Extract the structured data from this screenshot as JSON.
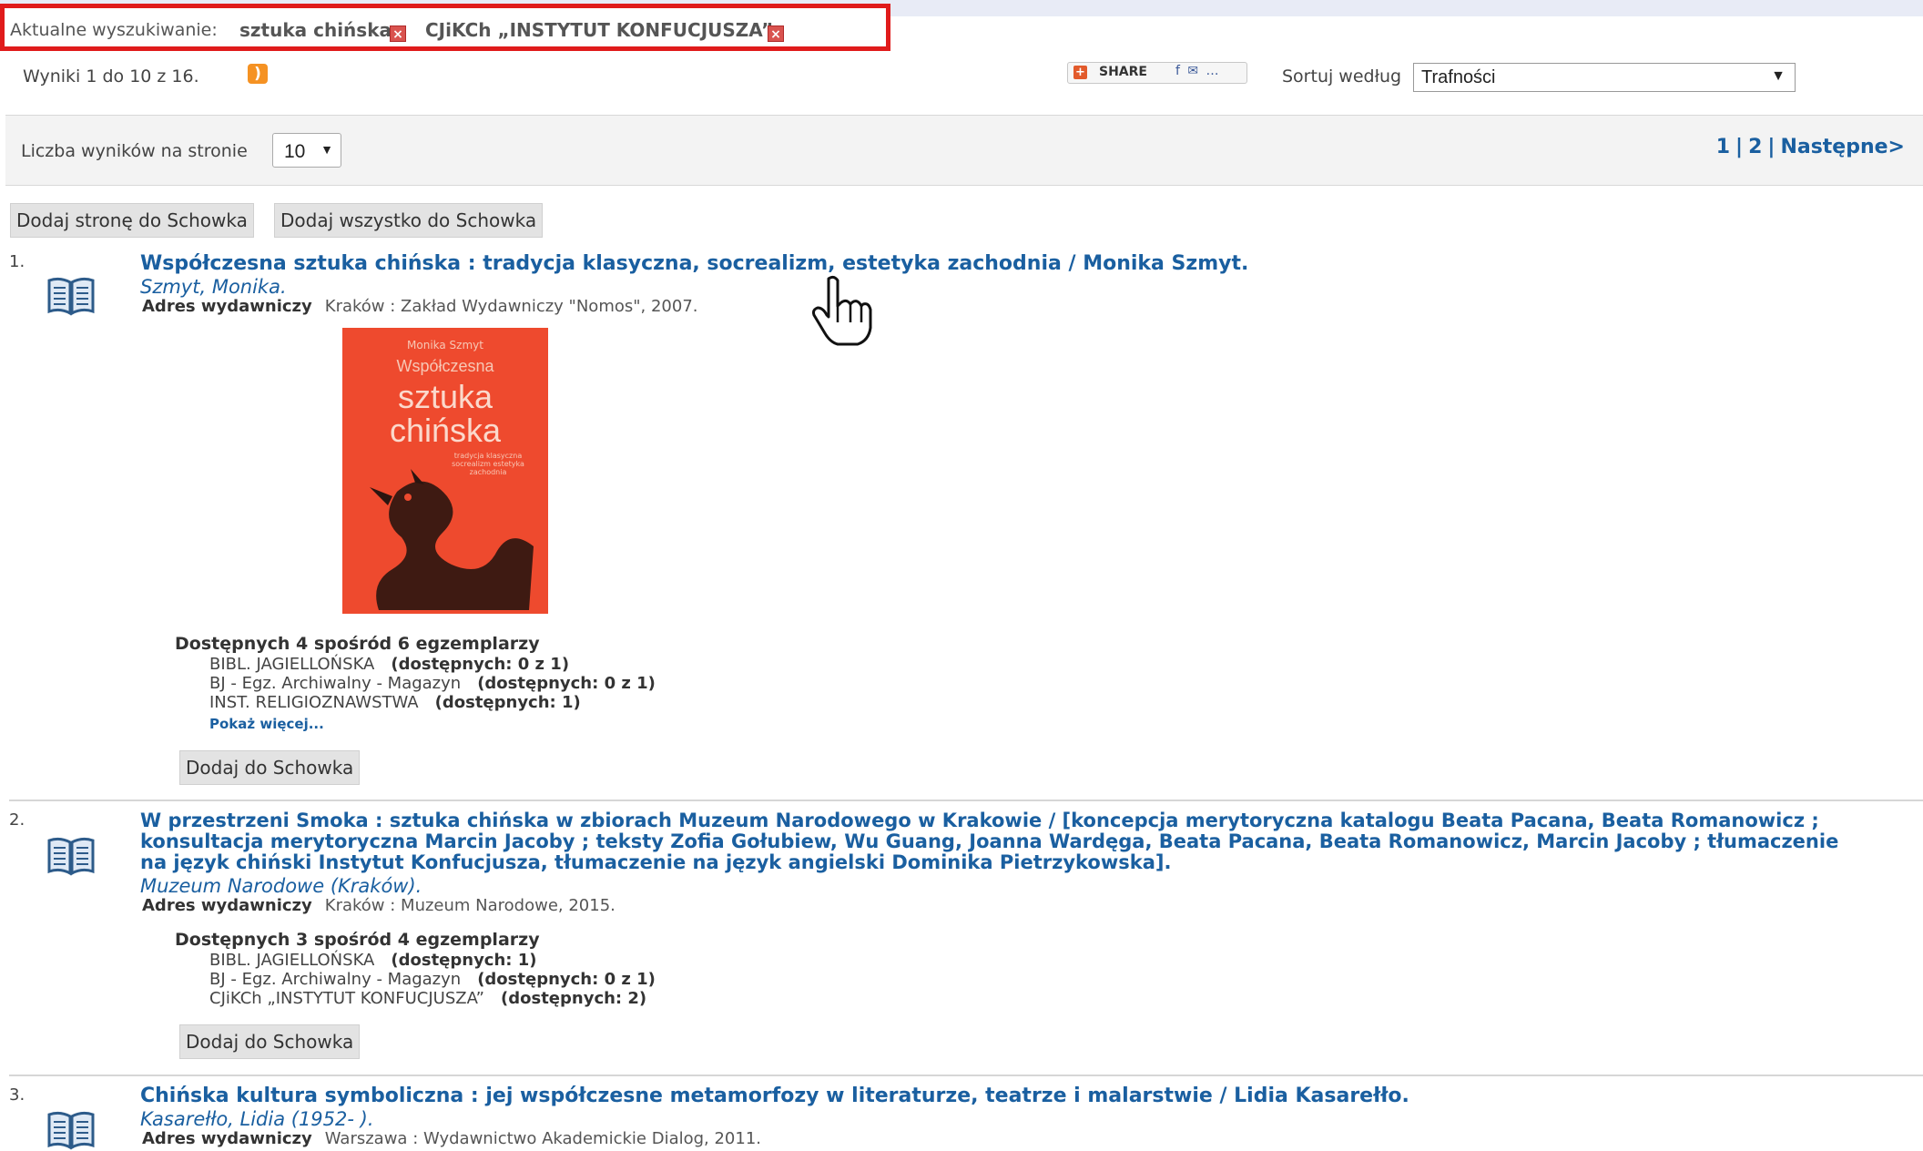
{
  "search": {
    "label": "Aktualne wyszukiwanie:",
    "terms": [
      "sztuka chińska",
      "CJiKCh „INSTYTUT KONFUCJUSZA”"
    ],
    "remove_glyph": "×"
  },
  "results_summary": "Wyniki 1 do 10 z 16.",
  "rss_icon": "rss-icon",
  "share": {
    "label": "SHARE",
    "social": "f ✉ …",
    "plus": "+"
  },
  "sort": {
    "label": "Sortuj według",
    "value": "Trafności",
    "arrow": "▼"
  },
  "per_page": {
    "label": "Liczba wyników na stronie",
    "value": "10",
    "arrow": "▼"
  },
  "pager": {
    "pages": [
      "1",
      "2"
    ],
    "separator": "|",
    "next": "Następne>"
  },
  "actions": {
    "add_page": "Dodaj stronę do Schowka",
    "add_all": "Dodaj wszystko do Schowka"
  },
  "results": [
    {
      "number": "1.",
      "title": "Współczesna sztuka chińska : tradycja klasyczna, socrealizm, estetyka zachodnia / Monika Szmyt.",
      "author": "Szmyt, Monika.",
      "publisher_label": "Adres wydawniczy",
      "publisher": "Kraków : Zakład Wydawniczy \"Nomos\", 2007.",
      "cover": {
        "author": "Monika Szmyt",
        "line1": "Współczesna",
        "line2": "sztuka",
        "line3": "chińska",
        "subtitle": "tradycja klasyczna socrealizm estetyka zachodnia"
      },
      "availability": "Dostępnych 4 spośród 6 egzemplarzy",
      "holdings": [
        {
          "location": "BIBL. JAGIELLOŃSKA",
          "status": "(dostępnych: 0 z 1)"
        },
        {
          "location": "BJ - Egz. Archiwalny - Magazyn",
          "status": "(dostępnych: 0 z 1)"
        },
        {
          "location": "INST. RELIGIOZNAWSTWA",
          "status": "(dostępnych: 1)"
        }
      ],
      "more": "Pokaż więcej...",
      "add_button": "Dodaj do Schowka"
    },
    {
      "number": "2.",
      "title_lines": [
        "W przestrzeni Smoka : sztuka chińska w zbiorach Muzeum Narodowego w Krakowie / [koncepcja merytoryczna katalogu Beata Pacana, Beata Romanowicz ;",
        "konsultacja merytoryczna Marcin Jacoby ; teksty Zofia Gołubiew, Wu Guang, Joanna Wardęga, Beata Pacana, Beata Romanowicz, Marcin Jacoby ; tłumaczenie",
        "na język chiński Instytut Konfucjusza, tłumaczenie na język angielski Dominika Pietrzykowska]."
      ],
      "author": "Muzeum Narodowe (Kraków).",
      "publisher_label": "Adres wydawniczy",
      "publisher": "Kraków : Muzeum Narodowe, 2015.",
      "availability": "Dostępnych 3 spośród 4 egzemplarzy",
      "holdings": [
        {
          "location": "BIBL. JAGIELLOŃSKA",
          "status": "(dostępnych: 1)"
        },
        {
          "location": "BJ - Egz. Archiwalny - Magazyn",
          "status": "(dostępnych: 0 z 1)"
        },
        {
          "location": "CJiKCh „INSTYTUT KONFUCJUSZA”",
          "status": "(dostępnych: 2)"
        }
      ],
      "add_button": "Dodaj do Schowka"
    },
    {
      "number": "3.",
      "title": "Chińska kultura symboliczna : jej współczesne metamorfozy w literaturze, teatrze i malarstwie / Lidia Kasarełło.",
      "author": "Kasarełło, Lidia (1952- ).",
      "publisher_label": "Adres wydawniczy",
      "publisher": "Warszawa : Wydawnictwo Akademickie Dialog, 2011."
    }
  ],
  "colors": {
    "link": "#1a5fa0",
    "highlight_border": "#e01b1b",
    "cover": "#ee4a2e",
    "rss": "#f59223"
  }
}
